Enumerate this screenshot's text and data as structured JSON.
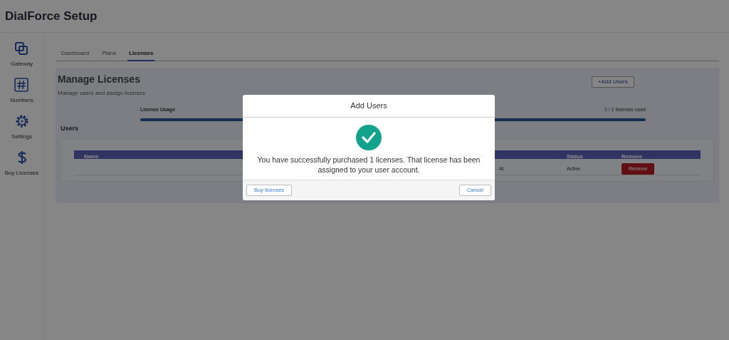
{
  "app": {
    "title": "DialForce Setup"
  },
  "sidebar": {
    "items": [
      {
        "label": "Gateway",
        "kind": "gateway"
      },
      {
        "label": "Numbers",
        "kind": "numbers"
      },
      {
        "label": "Settings",
        "kind": "settings"
      },
      {
        "label": "Buy Licenses",
        "kind": "dollar"
      }
    ]
  },
  "tabs": [
    {
      "label": "Dashboard",
      "selected": false
    },
    {
      "label": "Plans",
      "selected": false
    },
    {
      "label": "Licenses",
      "selected": true
    }
  ],
  "page": {
    "title": "Manage Licenses",
    "subtitle": "Manage users and assign licenses",
    "add_button": "+Add Users"
  },
  "usage": {
    "label": "License Usage",
    "reading": "1 / 1 licenses used",
    "level": 1
  },
  "users": {
    "title": "Users",
    "columns": [
      "Name",
      "",
      "Status",
      "Remove"
    ],
    "rows": [
      {
        "cells": [
          "",
          "Al",
          "Active"
        ],
        "remove": "Remove"
      }
    ]
  },
  "dialog": {
    "title": "Add Users",
    "message": "You have successfully purchased 1 licenses. That license has been assigned to your user account.",
    "buttons": [
      "Buy licenses",
      "Cancel"
    ]
  }
}
